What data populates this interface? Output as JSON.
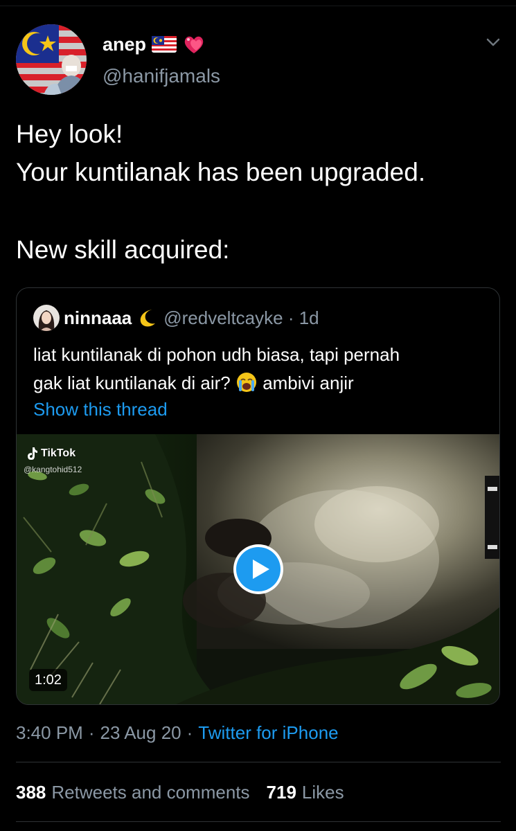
{
  "author": {
    "display_name": "anep",
    "handle": "@hanifjamals",
    "badges": [
      "malaysia-flag-icon",
      "heart-icon"
    ]
  },
  "tweet": {
    "lines": [
      "Hey look!",
      "Your kuntilanak has been upgraded.",
      "New skill acquired:"
    ]
  },
  "quoted": {
    "display_name": "ninnaaa",
    "handle_time": "@redveltcayke · 1d",
    "text_line1": "liat kuntilanak di pohon udh biasa, tapi pernah",
    "text_line2_a": "gak liat kuntilanak di air?",
    "text_line2_b": "ambivi anjir",
    "show_thread": "Show this thread",
    "video": {
      "watermark": "TikTok",
      "watermark_handle": "@kangtohid512",
      "duration": "1:02"
    }
  },
  "meta": {
    "time": "3:40 PM",
    "date": "23 Aug 20",
    "separator": "·",
    "source": "Twitter for iPhone"
  },
  "stats": {
    "retweets_count": "388",
    "retweets_label": "Retweets and comments",
    "likes_count": "719",
    "likes_label": "Likes"
  },
  "colors": {
    "background": "#000000",
    "link": "#1d9bf0",
    "muted": "#8b98a5"
  }
}
